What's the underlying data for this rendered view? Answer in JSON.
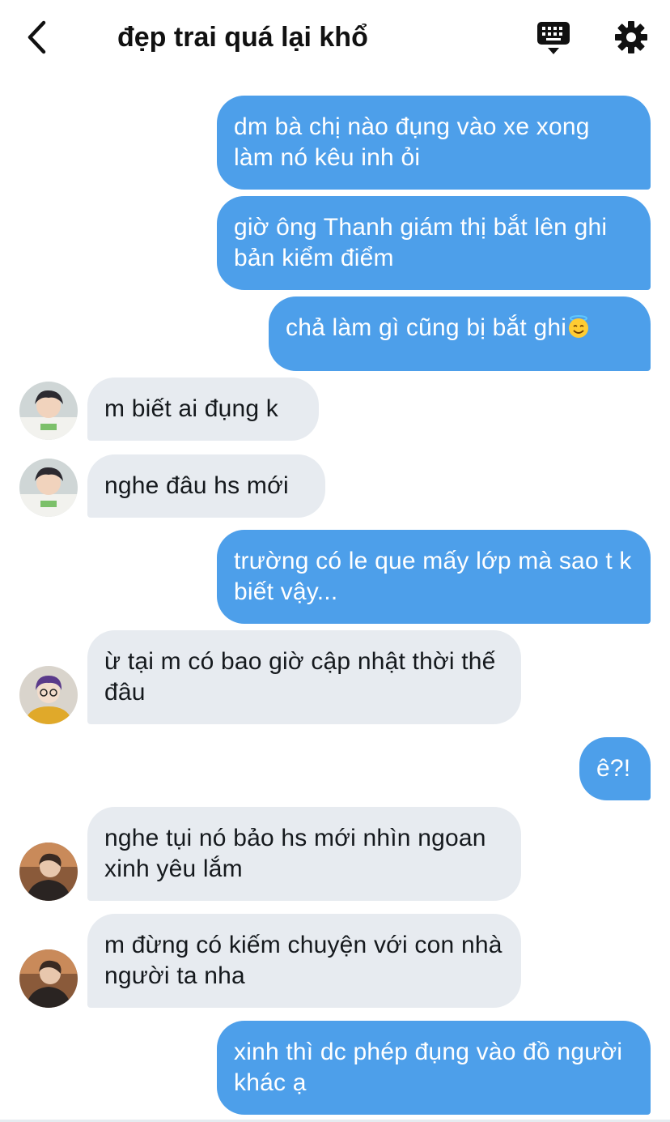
{
  "header": {
    "title": "đẹp trai quá lại khổ",
    "back_icon": "chevron-left-icon",
    "keyboard_icon": "keyboard-icon",
    "settings_icon": "gear-icon"
  },
  "colors": {
    "outgoing_bubble": "#4d9fea",
    "incoming_bubble": "#e7ebf0"
  },
  "messages": [
    {
      "side": "out",
      "text": "dm bà chị nào đụng vào xe xong làm nó kêu inh ỏi"
    },
    {
      "side": "out",
      "text": "giờ ông Thanh giám thị bắt lên ghi bản kiểm điểm"
    },
    {
      "side": "out",
      "text": "chả làm gì cũng bị bắt ghi",
      "emoji": "smiling-face-with-halo"
    },
    {
      "side": "in",
      "text": "m biết ai đụng k",
      "avatar": "avatar-boy-1"
    },
    {
      "side": "in",
      "text": "nghe đâu hs mới",
      "avatar": "avatar-boy-1"
    },
    {
      "side": "out",
      "text": "trường có le que mấy lớp mà sao t k biết vậy..."
    },
    {
      "side": "in",
      "text": "ừ tại m có bao giờ cập nhật thời thế đâu",
      "avatar": "avatar-boy-2"
    },
    {
      "side": "out",
      "text": "ê?!"
    },
    {
      "side": "in",
      "text": "nghe tụi nó bảo hs mới nhìn ngoan xinh yêu lắm",
      "avatar": "avatar-boy-3"
    },
    {
      "side": "in",
      "text": "m đừng có kiếm chuyện với con nhà người ta nha",
      "avatar": "avatar-boy-3"
    },
    {
      "side": "out",
      "text": "xinh thì dc phép đụng vào đồ người khác ạ"
    }
  ]
}
